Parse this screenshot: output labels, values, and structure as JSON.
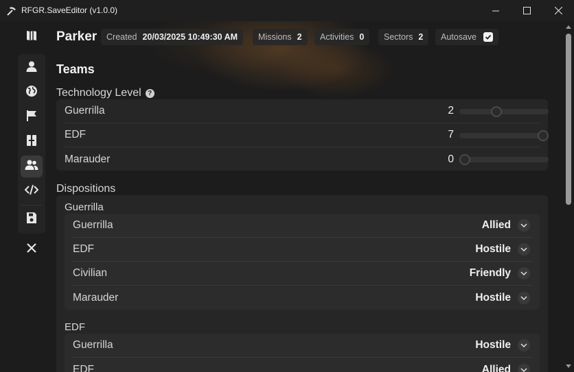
{
  "window": {
    "title": "RFGR.SaveEditor (v1.0.0)",
    "icons": {
      "app": "pickaxe-icon",
      "minimize": "minimize-icon",
      "maximize": "maximize-icon",
      "close": "close-icon"
    }
  },
  "sidebar": {
    "items": [
      {
        "name": "overview",
        "icon": "map-book-icon"
      },
      {
        "name": "player",
        "icon": "user-icon"
      },
      {
        "name": "world",
        "icon": "globe-icon"
      },
      {
        "name": "missions",
        "icon": "flag-icon"
      },
      {
        "name": "buildings",
        "icon": "columns-icon"
      },
      {
        "name": "teams",
        "icon": "users-icon",
        "active": true
      },
      {
        "name": "developer",
        "icon": "code-icon"
      },
      {
        "name": "save",
        "icon": "floppy-icon"
      },
      {
        "name": "exit",
        "icon": "x-icon"
      }
    ]
  },
  "header": {
    "profile_name": "Parker",
    "created_label": "Created",
    "created_value": "20/03/2025 10:49:30 AM",
    "missions_label": "Missions",
    "missions_value": "2",
    "activities_label": "Activities",
    "activities_value": "0",
    "sectors_label": "Sectors",
    "sectors_value": "2",
    "autosave_label": "Autosave",
    "autosave_checked": true
  },
  "page": {
    "title": "Teams",
    "tech_heading": "Technology Level",
    "dispositions_heading": "Dispositions"
  },
  "technology": [
    {
      "team": "Guerrilla",
      "value": "2",
      "fraction": 0.4
    },
    {
      "team": "EDF",
      "value": "7",
      "fraction": 1.0
    },
    {
      "team": "Marauder",
      "value": "0",
      "fraction": 0.0
    }
  ],
  "dispositions": [
    {
      "team": "Guerrilla",
      "relations": [
        {
          "target": "Guerrilla",
          "value": "Allied"
        },
        {
          "target": "EDF",
          "value": "Hostile"
        },
        {
          "target": "Civilian",
          "value": "Friendly"
        },
        {
          "target": "Marauder",
          "value": "Hostile"
        }
      ]
    },
    {
      "team": "EDF",
      "relations": [
        {
          "target": "Guerrilla",
          "value": "Hostile"
        },
        {
          "target": "EDF",
          "value": "Allied"
        }
      ]
    }
  ]
}
